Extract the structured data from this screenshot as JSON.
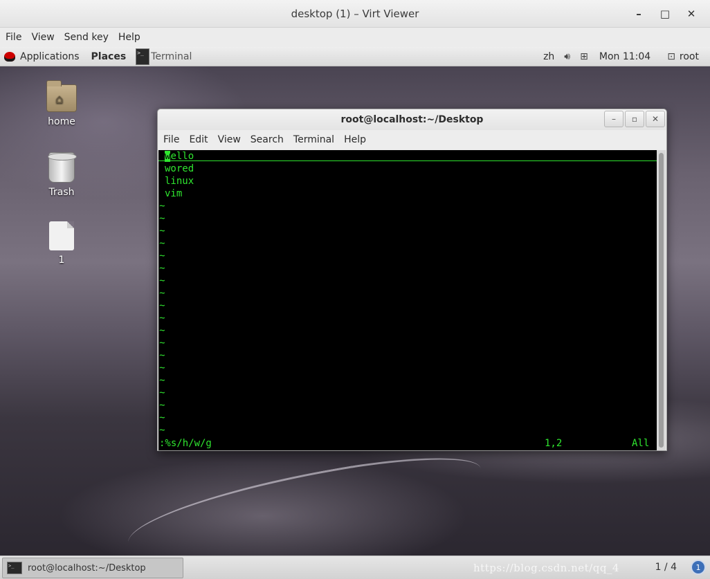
{
  "viewer": {
    "title": "desktop (1) – Virt Viewer",
    "window_buttons": {
      "minimize": "–",
      "maximize": "□",
      "close": "✕"
    },
    "menu": [
      "File",
      "View",
      "Send key",
      "Help"
    ]
  },
  "top_panel": {
    "applications": "Applications",
    "places": "Places",
    "task_terminal": "Terminal",
    "language": "zh",
    "clock": "Mon 11:04",
    "user": "root",
    "icons": [
      "redhat-icon",
      "terminal-icon",
      "volume-icon",
      "network-icon",
      "user-icon"
    ]
  },
  "desktop_icons": [
    {
      "label": "home",
      "icon": "home-folder-icon"
    },
    {
      "label": "Trash",
      "icon": "trash-icon"
    },
    {
      "label": "1",
      "icon": "file-icon"
    }
  ],
  "terminal": {
    "title": "root@localhost:~/Desktop",
    "menu": [
      "File",
      "Edit",
      "View",
      "Search",
      "Terminal",
      "Help"
    ],
    "lines": [
      "wello",
      "wored",
      "linux",
      "vim"
    ],
    "first_char": "w",
    "first_rest": "ello",
    "tilde": "~",
    "command": ":%s/h/w/g",
    "position": "1,2",
    "scroll": "All",
    "text_color": "#2fe62f"
  },
  "bottom_panel": {
    "task_label": "root@localhost:~/Desktop",
    "watermark": "https://blog.csdn.net/qq_4",
    "workspace": "1 / 4",
    "notifications": "1"
  }
}
